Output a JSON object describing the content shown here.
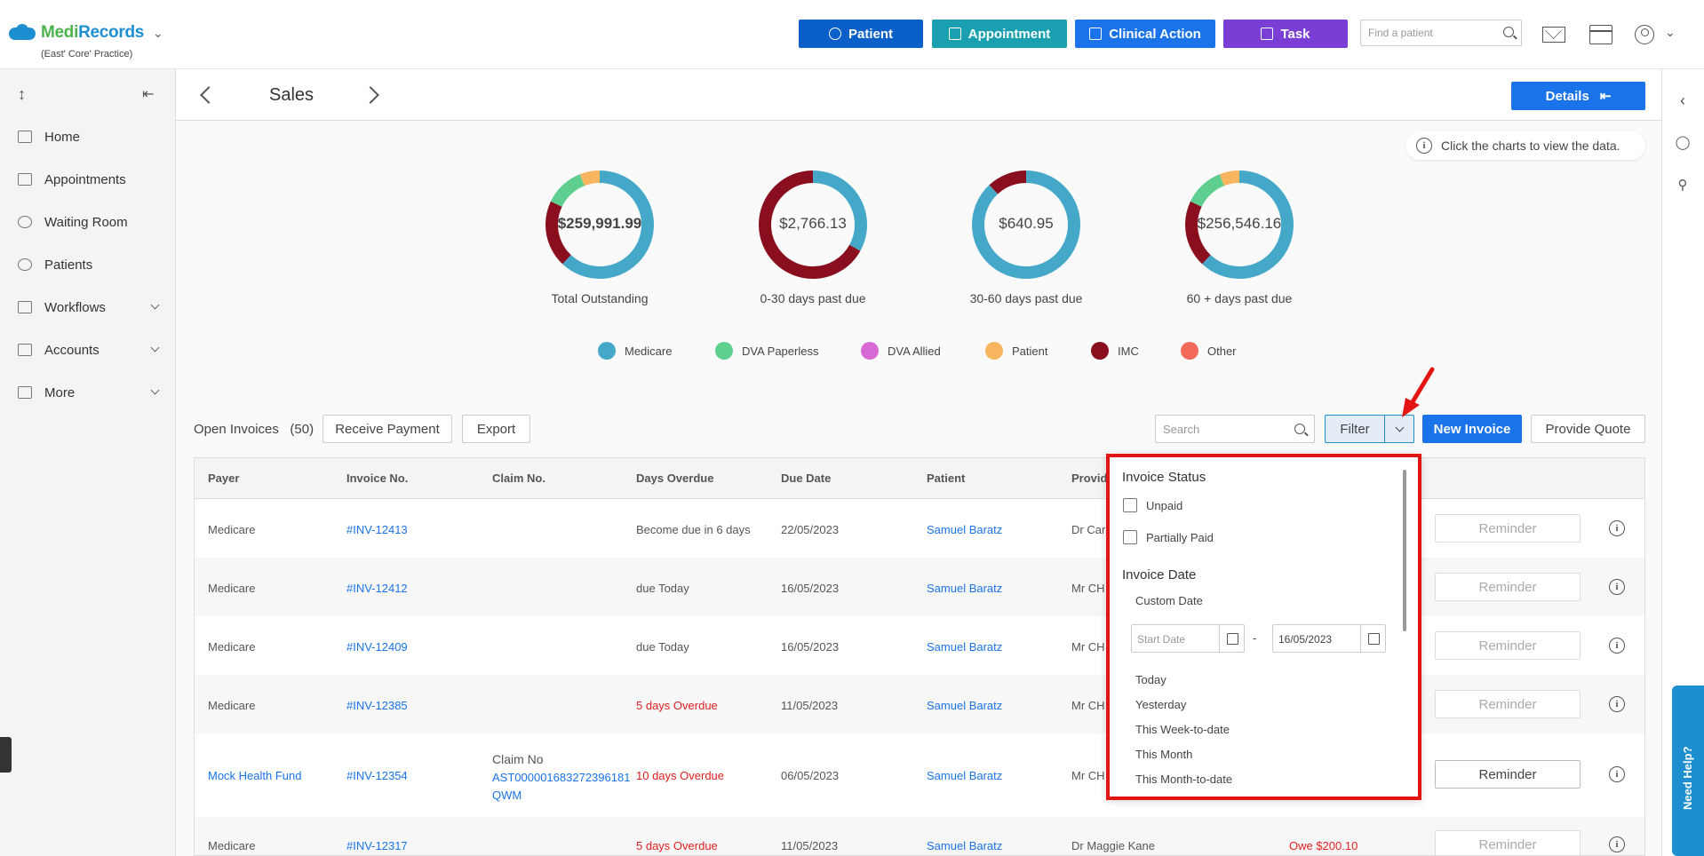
{
  "app": {
    "logo_medi": "Medi",
    "logo_records": "Records",
    "practice": "(East' Core' Practice)"
  },
  "topbar": {
    "patient_btn": "Patient",
    "appointment_btn": "Appointment",
    "clinical_btn": "Clinical Action",
    "task_btn": "Task",
    "find_placeholder": "Find a patient",
    "colors": {
      "patient": "#0b5fc8",
      "appointment": "#1aa0b0",
      "clinical": "#1a73e8",
      "task": "#7b3ed4"
    }
  },
  "sidebar": {
    "items": [
      {
        "label": "Home",
        "icon": "home-icon"
      },
      {
        "label": "Appointments",
        "icon": "calendar-icon"
      },
      {
        "label": "Waiting Room",
        "icon": "people-icon"
      },
      {
        "label": "Patients",
        "icon": "patient-icon"
      },
      {
        "label": "Workflows",
        "icon": "workflow-icon"
      },
      {
        "label": "Accounts",
        "icon": "folder-icon"
      },
      {
        "label": "More",
        "icon": "more-folder-icon"
      }
    ]
  },
  "header": {
    "title": "Sales",
    "details_btn": "Details"
  },
  "info_tip": "Click the charts to view the data.",
  "donuts": [
    {
      "value": "$259,991.99",
      "label": "Total Outstanding",
      "segments": [
        {
          "series": "Medicare",
          "fraction": 0.62
        },
        {
          "series": "IMC",
          "fraction": 0.2
        },
        {
          "series": "DVA Paperless",
          "fraction": 0.12
        },
        {
          "series": "Patient",
          "fraction": 0.06
        }
      ]
    },
    {
      "value": "$2,766.13",
      "label": "0-30 days past due",
      "segments": [
        {
          "series": "Medicare",
          "fraction": 0.33
        },
        {
          "series": "IMC",
          "fraction": 0.67
        }
      ]
    },
    {
      "value": "$640.95",
      "label": "30-60 days past due",
      "segments": [
        {
          "series": "Medicare",
          "fraction": 0.88
        },
        {
          "series": "IMC",
          "fraction": 0.12
        }
      ]
    },
    {
      "value": "$256,546.16",
      "label": "60 + days past due",
      "segments": [
        {
          "series": "Medicare",
          "fraction": 0.62
        },
        {
          "series": "IMC",
          "fraction": 0.2
        },
        {
          "series": "DVA Paperless",
          "fraction": 0.12
        },
        {
          "series": "Patient",
          "fraction": 0.06
        }
      ]
    }
  ],
  "legend": [
    {
      "name": "Medicare",
      "color": "#45a8c9"
    },
    {
      "name": "DVA Paperless",
      "color": "#5fcf8f"
    },
    {
      "name": "DVA Allied",
      "color": "#d86ad8"
    },
    {
      "name": "Patient",
      "color": "#f7b560"
    },
    {
      "name": "IMC",
      "color": "#8a0f1e"
    },
    {
      "name": "Other",
      "color": "#f26a5a"
    }
  ],
  "toolbar": {
    "open_invoices": "Open Invoices",
    "count": "(50)",
    "receive_payment": "Receive Payment",
    "export": "Export",
    "search_placeholder": "Search",
    "filter": "Filter",
    "new_invoice": "New Invoice",
    "provide_quote": "Provide Quote"
  },
  "table": {
    "headers": [
      "Payer",
      "Invoice No.",
      "Claim No.",
      "Days Overdue",
      "Due Date",
      "Patient",
      "Provid"
    ],
    "reminder": "Reminder",
    "rows": [
      {
        "payer": "Medicare",
        "invoice": "#INV-12413",
        "claim_title": "",
        "claim_no": "",
        "overdue": "Become due in 6 days",
        "due": "22/05/2023",
        "patient": "Samuel Baratz",
        "provider": "Dr Car",
        "owe": ""
      },
      {
        "payer": "Medicare",
        "invoice": "#INV-12412",
        "claim_title": "",
        "claim_no": "",
        "overdue": "due Today",
        "due": "16/05/2023",
        "patient": "Samuel Baratz",
        "provider": "Mr CH",
        "owe": ""
      },
      {
        "payer": "Medicare",
        "invoice": "#INV-12409",
        "claim_title": "",
        "claim_no": "",
        "overdue": "due Today",
        "due": "16/05/2023",
        "patient": "Samuel Baratz",
        "provider": "Mr CH",
        "owe": ""
      },
      {
        "payer": "Medicare",
        "invoice": "#INV-12385",
        "claim_title": "",
        "claim_no": "",
        "overdue": "5 days Overdue",
        "due": "11/05/2023",
        "patient": "Samuel Baratz",
        "provider": "Mr CH",
        "owe": ""
      },
      {
        "payer": "Mock Health Fund",
        "invoice": "#INV-12354",
        "claim_title": "Claim No",
        "claim_no": "AST000001683272396181",
        "claim_no2": "QWM",
        "overdue": "10 days Overdue",
        "due": "06/05/2023",
        "patient": "Samuel Baratz",
        "provider": "Mr CH",
        "owe": ""
      },
      {
        "payer": "Medicare",
        "invoice": "#INV-12317",
        "claim_title": "",
        "claim_no": "",
        "overdue": "5 days Overdue",
        "due": "11/05/2023",
        "patient": "Samuel Baratz",
        "provider": "Dr Maggie Kane",
        "owe": "Owe $200.10"
      }
    ]
  },
  "filter_dropdown": {
    "invoice_status": "Invoice Status",
    "unpaid": "Unpaid",
    "partially_paid": "Partially Paid",
    "invoice_date": "Invoice Date",
    "custom_date": "Custom Date",
    "start_placeholder": "Start Date",
    "end_date": "16/05/2023",
    "dash": "-",
    "options": [
      "Today",
      "Yesterday",
      "This Week-to-date",
      "This Month",
      "This Month-to-date"
    ]
  },
  "help": "Need Help?"
}
